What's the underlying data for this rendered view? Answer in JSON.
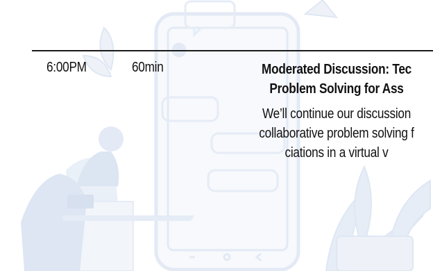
{
  "schedule": {
    "time": "6:00PM",
    "duration": "60min",
    "title_line1": "Moderated Discussion: Tec",
    "title_line2": "Problem Solving for Ass",
    "desc_line1": "We’ll continue our discussion",
    "desc_line2": "collaborative problem solving f",
    "desc_line3": "ciations in a virtual v"
  },
  "colors": {
    "illustration": "#e6edf7",
    "illustration_dark": "#d8e2f1",
    "rule": "#1a1a1a",
    "text": "#111111"
  },
  "icons": [
    "phone-illustration-icon",
    "person-with-laptop-icon",
    "plant-icon",
    "chat-bubble-icon"
  ]
}
